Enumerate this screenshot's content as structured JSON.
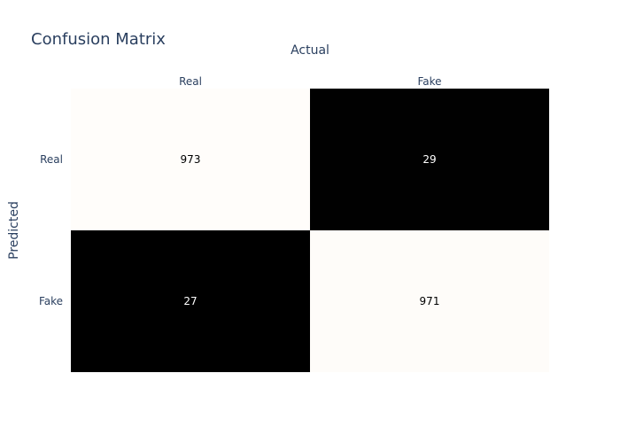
{
  "chart_data": {
    "type": "heatmap",
    "title": "Confusion Matrix",
    "xlabel": "Actual",
    "ylabel": "Predicted",
    "x_categories": [
      "Real",
      "Fake"
    ],
    "y_categories": [
      "Real",
      "Fake"
    ],
    "z": [
      [
        973,
        29
      ],
      [
        27,
        971
      ]
    ],
    "colorscale": [
      "#000000",
      "#fffdfa"
    ],
    "zrange": [
      27,
      973
    ],
    "showscale": false
  }
}
